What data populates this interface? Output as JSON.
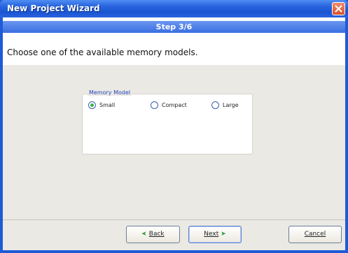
{
  "window": {
    "title": "New Project Wizard",
    "close_icon": "close-icon"
  },
  "step": {
    "label": "Step 3/6"
  },
  "instruction": "Choose one of the available memory models.",
  "memory_model": {
    "legend": "Memory Model",
    "options": [
      {
        "label": "Small",
        "selected": true
      },
      {
        "label": "Compact",
        "selected": false
      },
      {
        "label": "Large",
        "selected": false
      }
    ]
  },
  "buttons": {
    "back": "Back",
    "next": "Next",
    "cancel": "Cancel"
  },
  "colors": {
    "title_bar": "#2a66e0",
    "step_bar": "#3a6ee0",
    "radio_selected": "#3bb04a",
    "panel": "#ebe9e4"
  }
}
